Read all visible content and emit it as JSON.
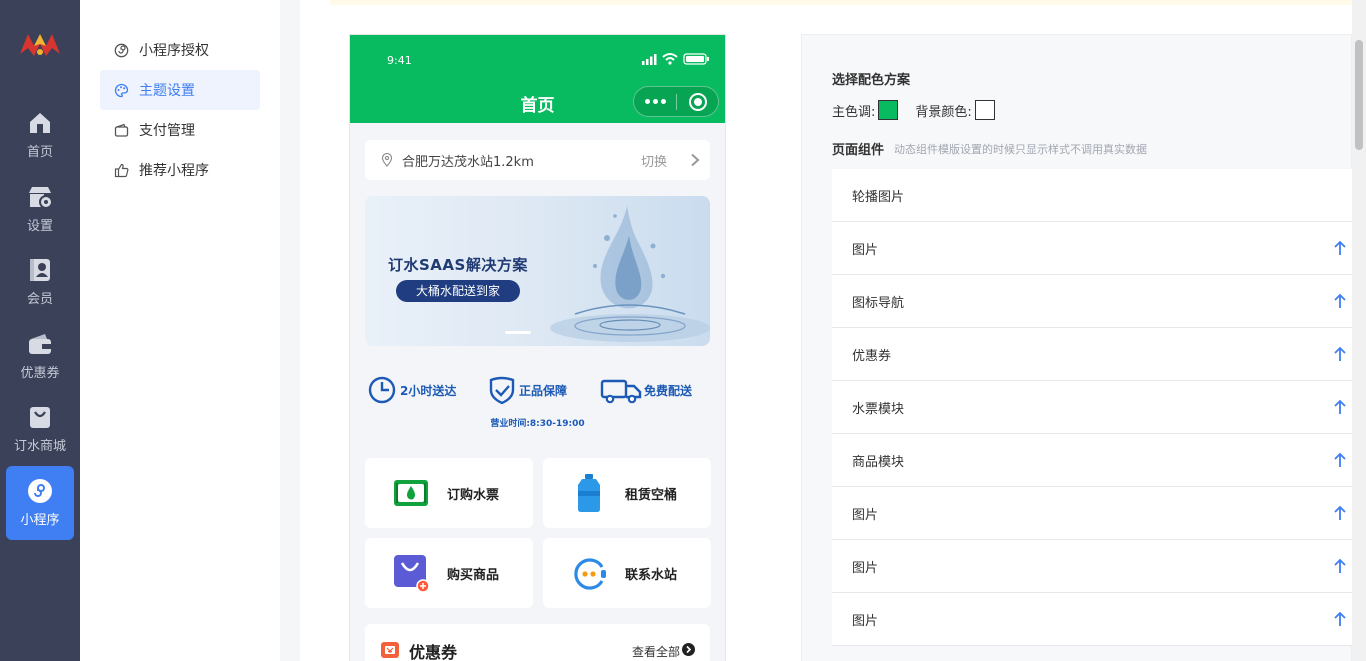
{
  "rail": {
    "items": [
      {
        "label": "首页",
        "icon": "home-icon"
      },
      {
        "label": "设置",
        "icon": "store-settings-icon"
      },
      {
        "label": "会员",
        "icon": "member-icon"
      },
      {
        "label": "优惠券",
        "icon": "wallet-icon"
      },
      {
        "label": "订水商城",
        "icon": "shop-bag-icon"
      },
      {
        "label": "小程序",
        "icon": "mini-program-icon",
        "active": true
      }
    ]
  },
  "subnav": {
    "items": [
      {
        "label": "小程序授权",
        "icon": "authorize-icon"
      },
      {
        "label": "主题设置",
        "icon": "palette-icon",
        "active": true
      },
      {
        "label": "支付管理",
        "icon": "payment-icon"
      },
      {
        "label": "推荐小程序",
        "icon": "thumbs-up-icon"
      }
    ]
  },
  "phone": {
    "time": "9:41",
    "title": "首页",
    "location": "合肥万达茂水站1.2km",
    "switch_label": "切换",
    "banner": {
      "title": "订水SAAS解决方案",
      "subtitle": "大桶水配送到家"
    },
    "features": [
      {
        "label": "2小时送达",
        "icon": "clock-icon"
      },
      {
        "label": "正品保障",
        "icon": "shield-check-icon"
      },
      {
        "label": "免费配送",
        "icon": "truck-icon"
      }
    ],
    "hours": "营业时间:8:30-19:00",
    "tiles": [
      {
        "label": "订购水票",
        "icon": "water-ticket-icon"
      },
      {
        "label": "租赁空桶",
        "icon": "water-bucket-icon"
      },
      {
        "label": "购买商品",
        "icon": "shopping-bag-icon"
      },
      {
        "label": "联系水站",
        "icon": "customer-service-icon"
      }
    ],
    "coupon": {
      "title": "优惠券",
      "more": "查看全部"
    }
  },
  "settings": {
    "scheme_title": "选择配色方案",
    "main_color_label": "主色调:",
    "main_color": "#09bb60",
    "bg_color_label": "背景颜色:",
    "bg_color": "#ffffff",
    "components_label": "页面组件",
    "components_hint": "动态组件模版设置的时候只显示样式不调用真实数据",
    "components": [
      {
        "label": "轮播图片",
        "arrow": false
      },
      {
        "label": "图片",
        "arrow": true
      },
      {
        "label": "图标导航",
        "arrow": true
      },
      {
        "label": "优惠券",
        "arrow": true
      },
      {
        "label": "水票模块",
        "arrow": true
      },
      {
        "label": "商品模块",
        "arrow": true
      },
      {
        "label": "图片",
        "arrow": true
      },
      {
        "label": "图片",
        "arrow": true
      },
      {
        "label": "图片",
        "arrow": true
      }
    ]
  },
  "colors": {
    "accent": "#3f7ef3",
    "rail_bg": "#3a4158",
    "brand_green": "#09bb60"
  }
}
